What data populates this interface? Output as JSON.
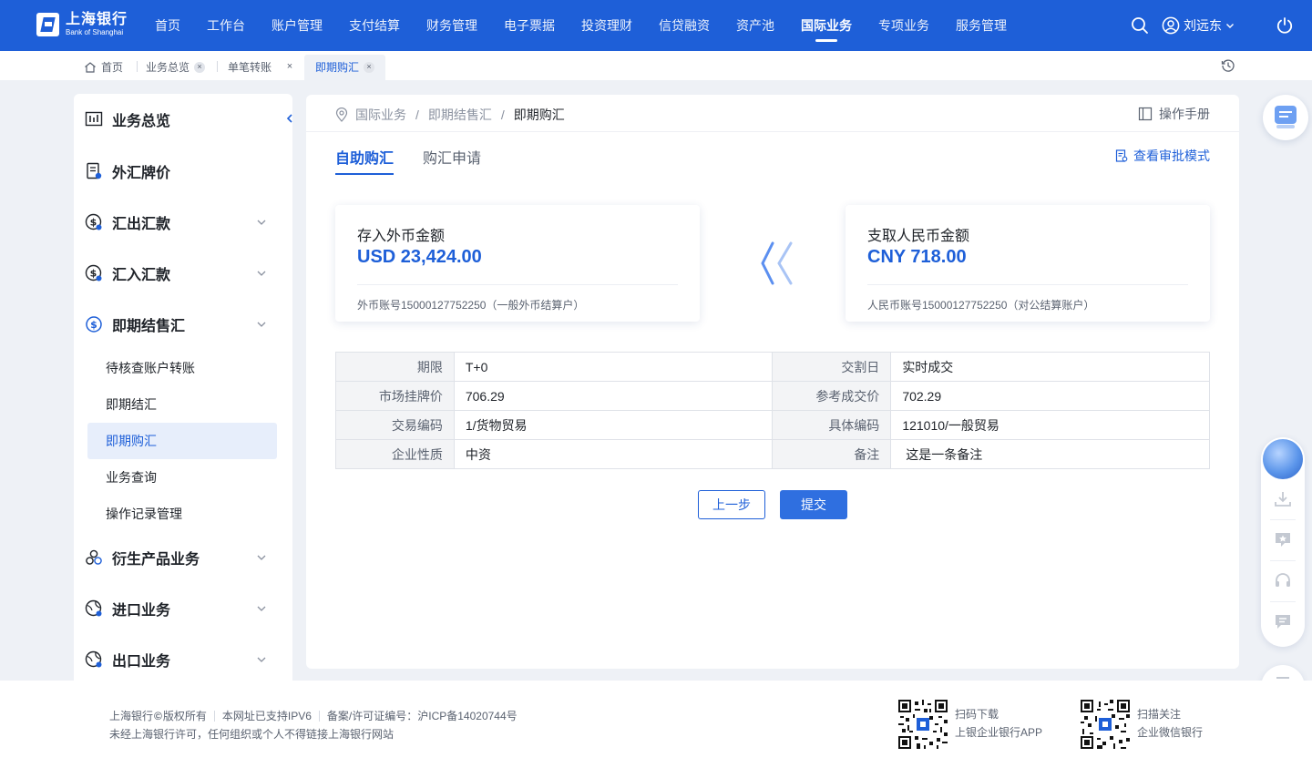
{
  "brand": {
    "name_cn": "上海银行",
    "name_en": "Bank of Shanghai",
    "color": "#1e5fd8"
  },
  "topnav": {
    "items": [
      "首页",
      "工作台",
      "账户管理",
      "支付结算",
      "财务管理",
      "电子票据",
      "投资理财",
      "信贷融资",
      "资产池",
      "国际业务",
      "专项业务",
      "服务管理"
    ],
    "active": "国际业务",
    "user": "刘远东"
  },
  "tabs": {
    "home": "首页",
    "items": [
      {
        "label": "业务总览"
      },
      {
        "label": "单笔转账"
      },
      {
        "label": "即期购汇"
      }
    ],
    "close_glyph": "×"
  },
  "sidebar": {
    "items": [
      {
        "label": "业务总览",
        "icon": "chart-bars-icon"
      },
      {
        "label": "外汇牌价",
        "icon": "document-icon"
      },
      {
        "label": "汇出汇款",
        "icon": "dollar-circle-icon"
      },
      {
        "label": "汇入汇款",
        "icon": "dollar-circle-icon"
      },
      {
        "label": "即期结售汇",
        "icon": "dollar-circle-icon"
      }
    ],
    "subitems": [
      "待核查账户转账",
      "即期结汇",
      "即期购汇",
      "业务查询",
      "操作记录管理"
    ],
    "active_sub": "即期购汇",
    "items_bottom": [
      {
        "label": "衍生产品业务",
        "icon": "circles-icon"
      },
      {
        "label": "进口业务",
        "icon": "globe-icon"
      },
      {
        "label": "出口业务",
        "icon": "globe-icon"
      }
    ]
  },
  "breadcrumb": {
    "items": [
      "国际业务",
      "即期结售汇",
      "即期购汇"
    ],
    "sep": "/"
  },
  "manual_label": "操作手册",
  "page_tabs": [
    "自助购汇",
    "购汇申请"
  ],
  "approve_link": "查看审批模式",
  "cards": {
    "left": {
      "title": "存入外币金额",
      "amount": "USD 23,424.00",
      "account": "外币账号15000127752250（一般外币结算户）"
    },
    "right": {
      "title": "支取人民币金额",
      "amount": "CNY 718.00",
      "account": "人民币账号15000127752250（对公结算账户）"
    }
  },
  "table": {
    "rows": [
      {
        "l1": "期限",
        "v1": "T+0",
        "l2": "交割日",
        "v2": "实时成交"
      },
      {
        "l1": "市场挂牌价",
        "v1": "706.29",
        "l2": "参考成交价",
        "v2": "702.29"
      },
      {
        "l1": "交易编码",
        "v1": "1/货物贸易",
        "l2": "具体编码",
        "v2": "121010/一般贸易"
      },
      {
        "l1": "企业性质",
        "v1": "中资",
        "l2": "备注",
        "v2": " 这是一条备注"
      }
    ]
  },
  "buttons": {
    "prev": "上一步",
    "submit": "提交"
  },
  "footer": {
    "copyright_prefix": "上海银行",
    "copyright_symbol": "©",
    "copyright_suffix": "版权所有",
    "ipv6": "本网址已支持IPV6",
    "icp": "备案/许可证编号：沪ICP备14020744号",
    "notice": "未经上海银行许可，任何组织或个人不得链接上海银行网站",
    "qr1": {
      "line1": "扫码下载",
      "line2": "上银企业银行APP"
    },
    "qr2": {
      "line1": "扫描关注",
      "line2": "企业微信银行"
    }
  }
}
